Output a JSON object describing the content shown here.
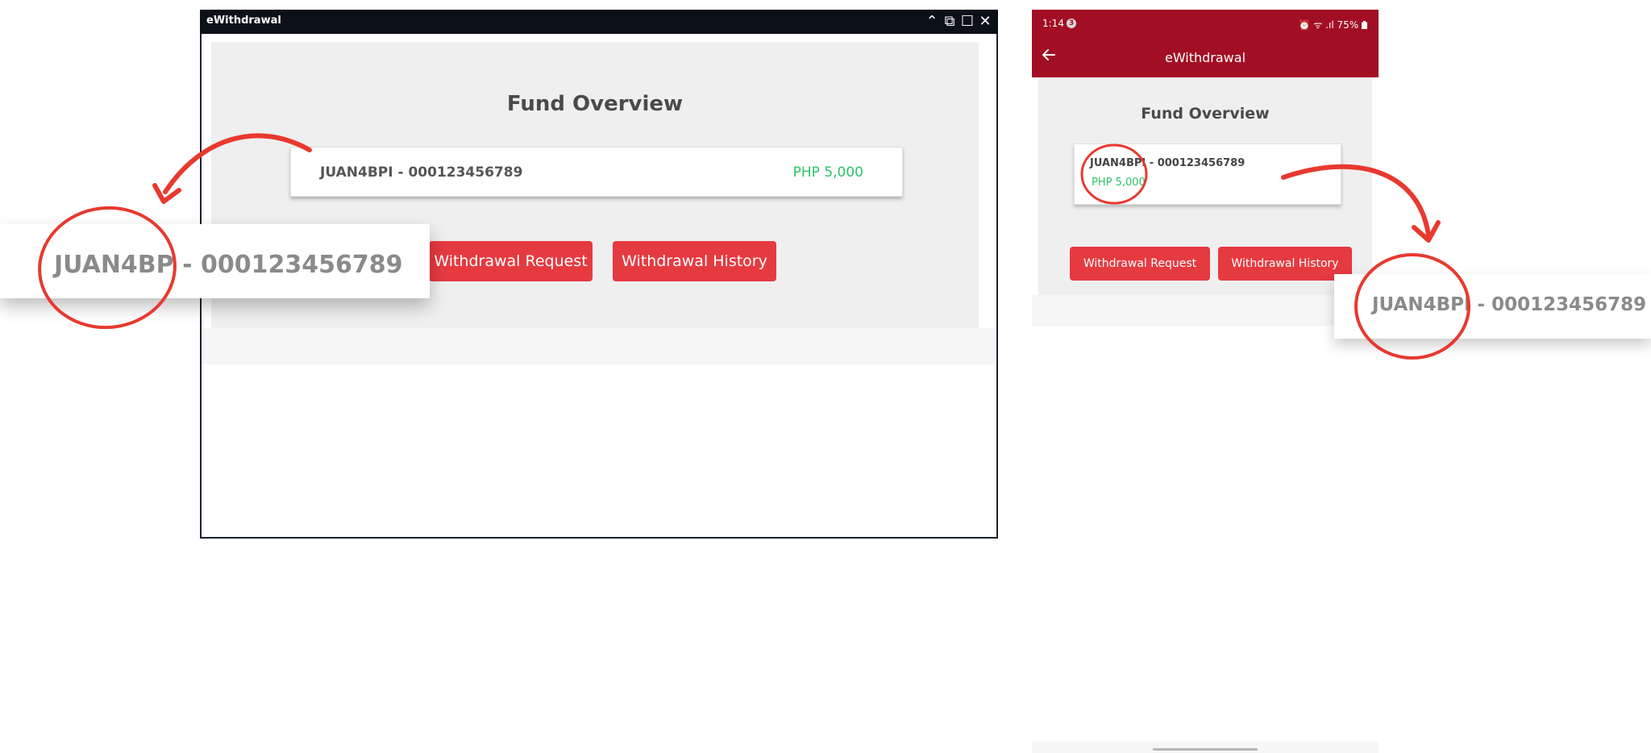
{
  "desktop": {
    "window_title": "eWithdrawal",
    "controls": {
      "collapse": "⌃",
      "pip": "⧉",
      "maximize": "☐",
      "close": "✕"
    },
    "heading": "Fund Overview",
    "account_label": "JUAN4BPI - 000123456789",
    "balance": "PHP 5,000",
    "withdrawal_request_label": "Withdrawal Request",
    "withdrawal_history_label": "Withdrawal History"
  },
  "zoom_left": {
    "text": "JUAN4BP - 000123456789"
  },
  "mobile": {
    "status": {
      "time": "1:14",
      "badge": "3",
      "indicators": "⏰ ᯤ .ıl 75%"
    },
    "app_title": "eWithdrawal",
    "heading": "Fund Overview",
    "account_label": "JUAN4BPI - 000123456789",
    "balance": "PHP 5,000",
    "withdrawal_request_label": "Withdrawal Request",
    "withdrawal_history_label": "Withdrawal History"
  },
  "zoom_right": {
    "text": "JUAN4BPI - 000123456789"
  },
  "colors": {
    "accent_red": "#e53a40",
    "mobile_bar": "#a20f24",
    "annotation": "#e8392f",
    "balance_green": "#2ec36a",
    "titlebar": "#0c1019"
  },
  "icons": {
    "back": "arrow-left-icon",
    "battery": "battery-icon"
  }
}
